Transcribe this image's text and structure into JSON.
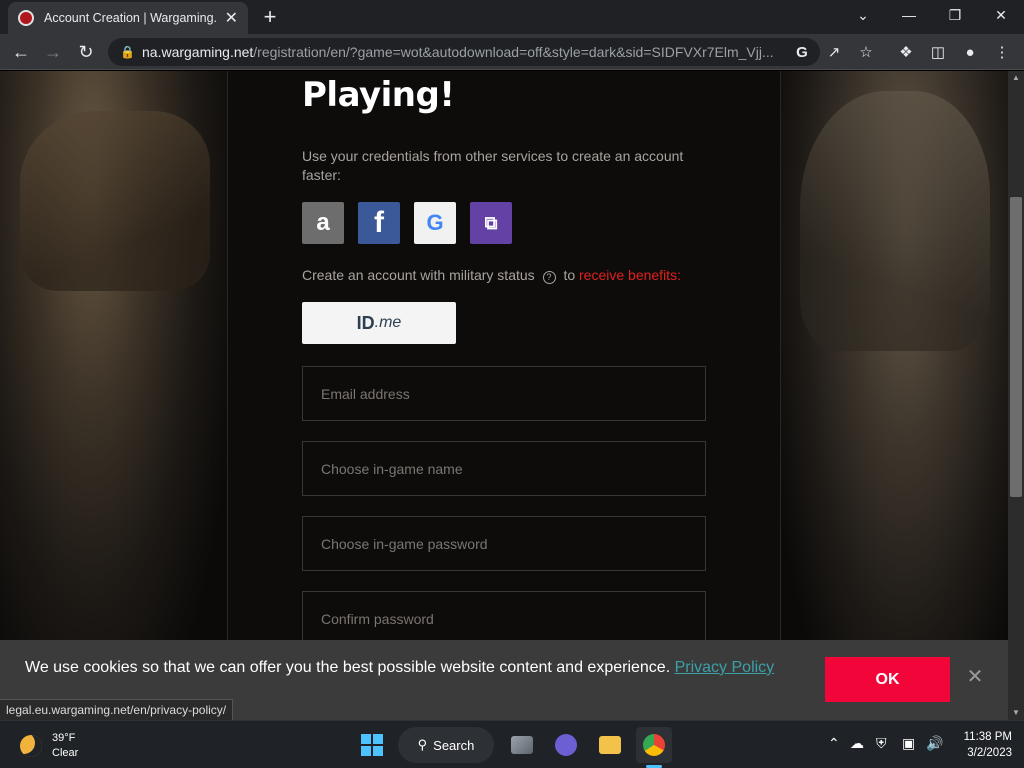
{
  "browser": {
    "tab_title": "Account Creation | Wargaming.net",
    "tab_close": "✕",
    "new_tab": "+",
    "window": {
      "minimize": "—",
      "maximize": "❐",
      "close": "✕",
      "dropdown": "⌄"
    },
    "url_host": "na.wargaming.net",
    "url_path": "/registration/en/?game=wot&autodownload=off&style=dark&sid=SIDFVXr7Elm_Vjj...",
    "icons": [
      "back-icon",
      "forward-icon",
      "reload-icon",
      "lock-icon",
      "google-icon",
      "share-icon",
      "star-icon",
      "extensions-icon",
      "sidepanel-icon",
      "profile-icon",
      "menu-icon"
    ]
  },
  "page": {
    "heading": "Playing!",
    "social_prompt": "Use your credentials from other services to create an account faster:",
    "social": {
      "amazon": "a",
      "facebook": "f",
      "google": "G",
      "twitch": "⧉"
    },
    "military_prefix": "Create an account with military status",
    "military_help": "?",
    "military_to": "to",
    "military_link": "receive benefits",
    "military_suffix": ":",
    "idme_id": "ID",
    "idme_me": ".me",
    "fields": {
      "email_placeholder": "Email address",
      "name_placeholder": "Choose in-game name",
      "password_placeholder": "Choose in-game password",
      "confirm_placeholder": "Confirm password"
    }
  },
  "cookie": {
    "message": "We use cookies so that we can offer you the best possible website content and experience.",
    "link": "Privacy Policy",
    "ok": "OK",
    "close": "✕"
  },
  "status_url": "legal.eu.wargaming.net/en/privacy-policy/",
  "taskbar": {
    "temp": "39°F",
    "condition": "Clear",
    "search": "Search",
    "time": "11:38 PM",
    "date": "3/2/2023",
    "accent": "#4cc2ff"
  },
  "colors": {
    "brand_red": "#f2063a",
    "link_red": "#e1211f",
    "link_teal": "#3ca0a6"
  }
}
